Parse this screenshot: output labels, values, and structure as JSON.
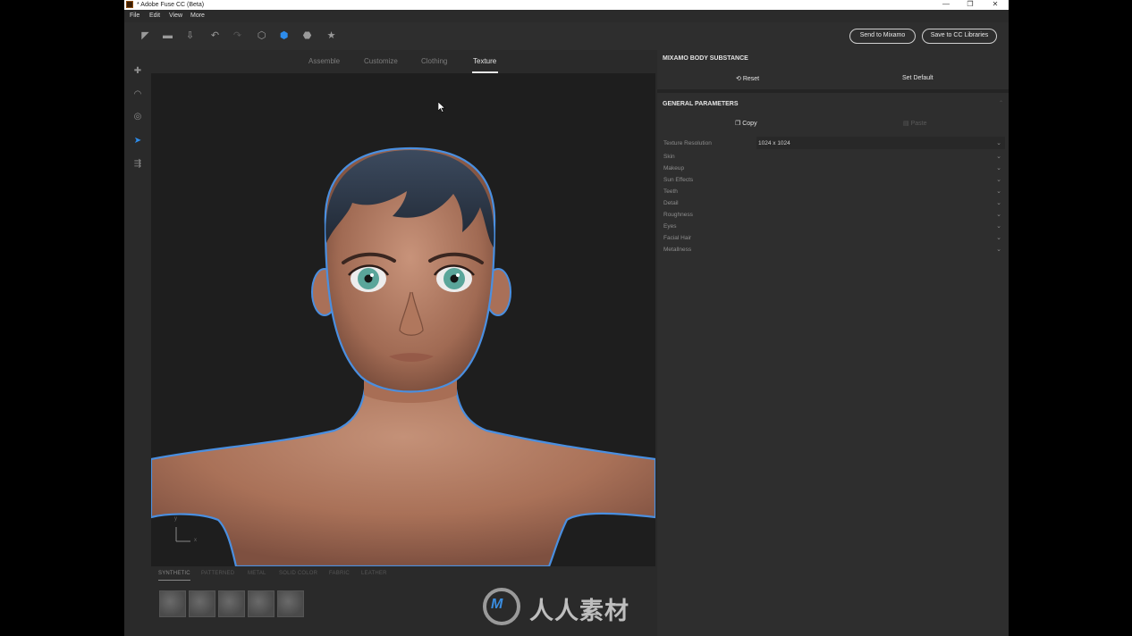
{
  "window": {
    "title": "* Adobe Fuse CC (Beta)",
    "controls": [
      "—",
      "❐",
      "✕"
    ]
  },
  "menu": [
    "File",
    "Edit",
    "View",
    "More"
  ],
  "toolbar": {
    "icons": [
      "send-icon",
      "open-folder-icon",
      "import-icon",
      "undo-icon",
      "redo-icon",
      "box-outline-icon",
      "box-solid-icon",
      "cube-icon",
      "star-icon"
    ],
    "send_to_mixamo": "Send to Mixamo",
    "save_to_cc": "Save to CC Libraries"
  },
  "left_tools": [
    "add-body-icon",
    "camera-orbit-icon",
    "target-icon",
    "pointer-icon",
    "export-pose-icon"
  ],
  "tabs": [
    "Assemble",
    "Customize",
    "Clothing",
    "Texture"
  ],
  "active_tab": "Texture",
  "viewport": {
    "axis_y": "y",
    "axis_x": "x"
  },
  "material_tabs": [
    "SYNTHETIC",
    "PATTERNED",
    "METAL",
    "SOLID COLOR",
    "FABRIC",
    "LEATHER"
  ],
  "right_panel": {
    "section1_title": "MIXAMO BODY SUBSTANCE",
    "reset": "Reset",
    "set_default": "Set Default",
    "section2_title": "GENERAL PARAMETERS",
    "copy": "Copy",
    "paste": "Paste",
    "texture_resolution_label": "Texture Resolution",
    "texture_resolution_value": "1024 x 1024",
    "params": [
      "Skin",
      "Makeup",
      "Sun Effects",
      "Teeth",
      "Detail",
      "Roughness",
      "Eyes",
      "Facial Hair",
      "Metallness"
    ]
  },
  "watermark": {
    "text": "人人素材",
    "logo_letter": "M"
  },
  "colors": {
    "accent": "#2d8ceb",
    "outline": "#4a8fe0",
    "skin": "#b98268",
    "hair": "#2b3748"
  }
}
